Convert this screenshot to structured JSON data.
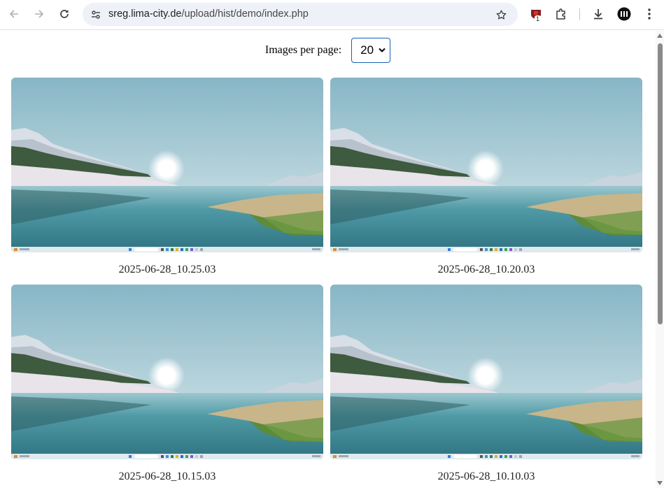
{
  "browser": {
    "url_host": "sreg.lima-city.de",
    "url_path": "/upload/hist/demo/index.php",
    "extension_badge": "1",
    "icons": [
      "back-arrow-icon",
      "forward-arrow-icon",
      "reload-icon",
      "site-settings-icon",
      "bookmark-star-icon",
      "shield-extension-icon",
      "puzzle-extensions-icon",
      "download-icon",
      "profile-icon",
      "more-vert-icon"
    ]
  },
  "page": {
    "per_page_label": "Images per page:",
    "per_page_value": "20",
    "images": [
      {
        "caption": "2025-06-28_10.25.03"
      },
      {
        "caption": "2025-06-28_10.20.03"
      },
      {
        "caption": "2025-06-28_10.15.03"
      },
      {
        "caption": "2025-06-28_10.10.03"
      }
    ]
  },
  "colors": {
    "select_border": "#1a5fb4",
    "omnibox_bg": "#eef1f8",
    "sky_top": "#8fb9c8",
    "water": "#3f8a97"
  }
}
